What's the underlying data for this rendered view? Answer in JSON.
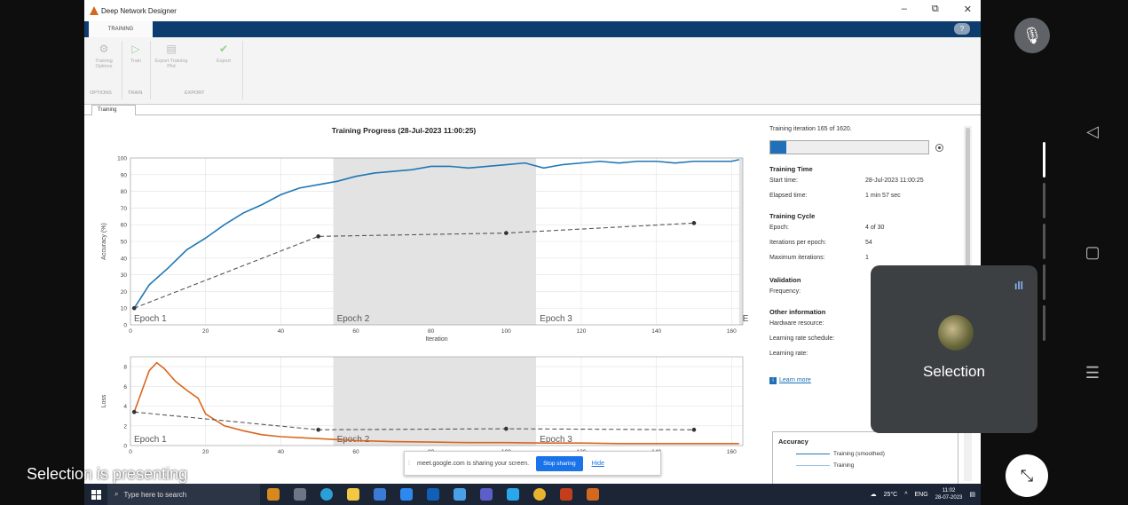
{
  "window": {
    "title": "Deep Network Designer",
    "min": "–",
    "restore": "⧉",
    "close": "✕"
  },
  "ribbon": {
    "tab": "TRAINING",
    "help": "?",
    "buttons": [
      {
        "label": "Training Options",
        "icon": "gear-icon"
      },
      {
        "label": "Train",
        "icon": "play-icon"
      },
      {
        "label": "Export Training Plot",
        "icon": "export-plot-icon"
      },
      {
        "label": "Export",
        "icon": "check-export-icon"
      }
    ],
    "groups": [
      "OPTIONS",
      "TRAIN",
      "EXPORT"
    ]
  },
  "doc_tab": "Training",
  "chart_title": "Training Progress (28-Jul-2023 11:00:25)",
  "chart_data": [
    {
      "type": "line",
      "title": "Training Progress (28-Jul-2023 11:00:25)",
      "xlabel": "Iteration",
      "ylabel": "Accuracy (%)",
      "xlim": [
        0,
        163
      ],
      "ylim": [
        0,
        100
      ],
      "xticks": [
        0,
        20,
        40,
        60,
        80,
        100,
        120,
        140,
        160
      ],
      "yticks": [
        0,
        10,
        20,
        30,
        40,
        50,
        60,
        70,
        80,
        90,
        100
      ],
      "grid": true,
      "epochs": [
        {
          "label": "Epoch 1",
          "start": 0,
          "end": 54
        },
        {
          "label": "Epoch 2",
          "start": 54,
          "end": 108
        },
        {
          "label": "Epoch 3",
          "start": 108,
          "end": 162
        },
        {
          "label": "E",
          "start": 162,
          "end": 163
        }
      ],
      "series": [
        {
          "name": "Training (smoothed)",
          "x": [
            1,
            5,
            10,
            15,
            20,
            25,
            30,
            35,
            40,
            45,
            50,
            55,
            60,
            65,
            70,
            75,
            80,
            85,
            90,
            95,
            100,
            105,
            110,
            115,
            120,
            125,
            130,
            135,
            140,
            145,
            150,
            155,
            160,
            162
          ],
          "y": [
            10,
            24,
            34,
            45,
            52,
            60,
            67,
            72,
            78,
            82,
            84,
            86,
            89,
            91,
            92,
            93,
            95,
            95,
            94,
            95,
            96,
            97,
            94,
            96,
            97,
            98,
            97,
            98,
            98,
            97,
            98,
            98,
            98,
            99
          ]
        },
        {
          "name": "Validation",
          "x": [
            1,
            50,
            100,
            150
          ],
          "y": [
            10,
            53,
            55,
            61
          ]
        }
      ]
    },
    {
      "type": "line",
      "xlabel": "Iteration",
      "ylabel": "Loss",
      "xlim": [
        0,
        163
      ],
      "ylim": [
        0,
        9
      ],
      "xticks": [
        0,
        20,
        40,
        60,
        80,
        100,
        120,
        140,
        160
      ],
      "yticks": [
        0,
        2,
        4,
        6,
        8
      ],
      "grid": true,
      "epochs": [
        {
          "label": "Epoch 1",
          "start": 0,
          "end": 54
        },
        {
          "label": "Epoch 2",
          "start": 54,
          "end": 108
        },
        {
          "label": "Epoch 3",
          "start": 108,
          "end": 162
        }
      ],
      "series": [
        {
          "name": "Training (smoothed)",
          "x": [
            1,
            3,
            5,
            7,
            9,
            12,
            15,
            18,
            20,
            25,
            30,
            35,
            40,
            50,
            60,
            70,
            80,
            90,
            100,
            110,
            120,
            130,
            140,
            150,
            160,
            162
          ],
          "y": [
            3.4,
            5.5,
            7.6,
            8.4,
            7.8,
            6.5,
            5.6,
            4.8,
            3.2,
            2.0,
            1.5,
            1.1,
            0.9,
            0.7,
            0.5,
            0.4,
            0.35,
            0.3,
            0.3,
            0.25,
            0.25,
            0.2,
            0.2,
            0.2,
            0.2,
            0.2
          ]
        },
        {
          "name": "Validation",
          "x": [
            1,
            50,
            100,
            150
          ],
          "y": [
            3.4,
            1.6,
            1.7,
            1.6
          ]
        }
      ]
    }
  ],
  "panel": {
    "iteration": "Training iteration 165 of 1620.",
    "progress": 0.102,
    "time_head": "Training Time",
    "start_k": "Start time:",
    "start_v": "28-Jul-2023 11:00:25",
    "elapsed_k": "Elapsed time:",
    "elapsed_v": "1 min 57 sec",
    "cycle_head": "Training Cycle",
    "epoch_k": "Epoch:",
    "epoch_v": "4 of 30",
    "ipe_k": "Iterations per epoch:",
    "ipe_v": "54",
    "max_k": "Maximum iterations:",
    "max_v": "1",
    "val_head": "Validation",
    "freq_k": "Frequency:",
    "other_head": "Other information",
    "hw_k": "Hardware resource:",
    "lrs_k": "Learning rate schedule:",
    "lr_k": "Learning rate:",
    "learn_more": "Learn more",
    "legend_head": "Accuracy",
    "legend_items": [
      "Training (smoothed)",
      "Training"
    ]
  },
  "share": {
    "text": "meet.google.com is sharing your screen.",
    "stop": "Stop sharing",
    "hide": "Hide"
  },
  "taskbar": {
    "search": "Type here to search",
    "temp": "25°C",
    "lang": "ENG",
    "time": "11:02",
    "date": "28-07-2023"
  },
  "meet": {
    "presenting": "Selection is presenting",
    "pip_name": "Selection"
  },
  "colors": {
    "accent": "#0c3d6e",
    "train_line": "#1f77b4",
    "loss_line": "#d9661f",
    "epoch_shade": "#e3e3e3"
  }
}
